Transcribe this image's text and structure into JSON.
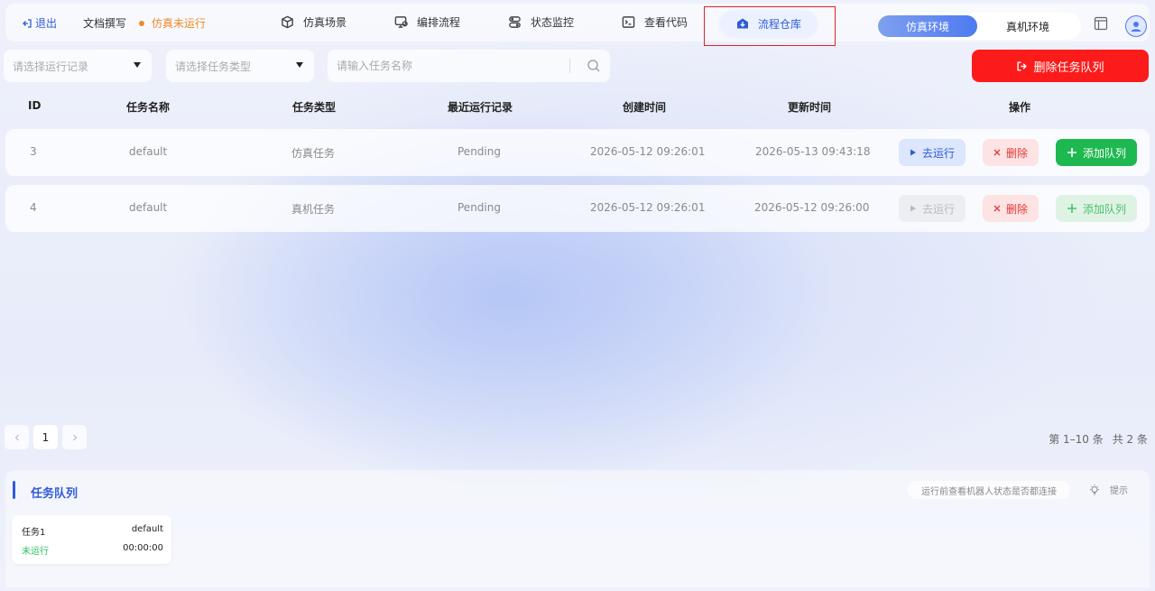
{
  "topbar": {
    "exit_label": "退出",
    "doc_label": "文档撰写",
    "status_label": "仿真未运行",
    "nav": [
      {
        "label": "仿真场景",
        "icon": "cube-icon"
      },
      {
        "label": "编排流程",
        "icon": "flow-icon"
      },
      {
        "label": "状态监控",
        "icon": "monitor-icon"
      },
      {
        "label": "查看代码",
        "icon": "code-icon"
      }
    ],
    "active_nav": {
      "label": "流程仓库",
      "icon": "warehouse-icon"
    },
    "env": {
      "sim": "仿真环境",
      "real": "真机环境"
    }
  },
  "filters": {
    "run_record_placeholder": "请选择运行记录",
    "task_type_placeholder": "请选择任务类型",
    "search_placeholder": "请输入任务名称",
    "delete_queue_label": "删除任务队列"
  },
  "table": {
    "headers": [
      "ID",
      "任务名称",
      "任务类型",
      "最近运行记录",
      "创建时间",
      "更新时间",
      "操作"
    ],
    "rows": [
      {
        "id": "3",
        "name": "default",
        "type": "仿真任务",
        "record": "Pending",
        "created": "2026-05-12 09:26:01",
        "updated": "2026-05-13 09:43:18",
        "run_enabled": true
      },
      {
        "id": "4",
        "name": "default",
        "type": "真机任务",
        "record": "Pending",
        "created": "2026-05-12 09:26:01",
        "updated": "2026-05-12 09:26:00",
        "run_enabled": false
      }
    ],
    "actions": {
      "run": "去运行",
      "delete": "删除",
      "add": "添加队列"
    }
  },
  "pagination": {
    "current": "1",
    "range": "第 1–10 条",
    "total": "共 2 条"
  },
  "queue": {
    "title": "任务队列",
    "hint": "运行前查看机器人状态是否都连接",
    "hint_button": "提示",
    "cards": [
      {
        "name": "任务1",
        "flow": "default",
        "status": "未运行",
        "time": "00:00:00"
      }
    ]
  },
  "colors": {
    "accent": "#2f5bd8",
    "danger": "#fb1b1b",
    "success": "#1db950",
    "warning": "#ee8a2a"
  }
}
